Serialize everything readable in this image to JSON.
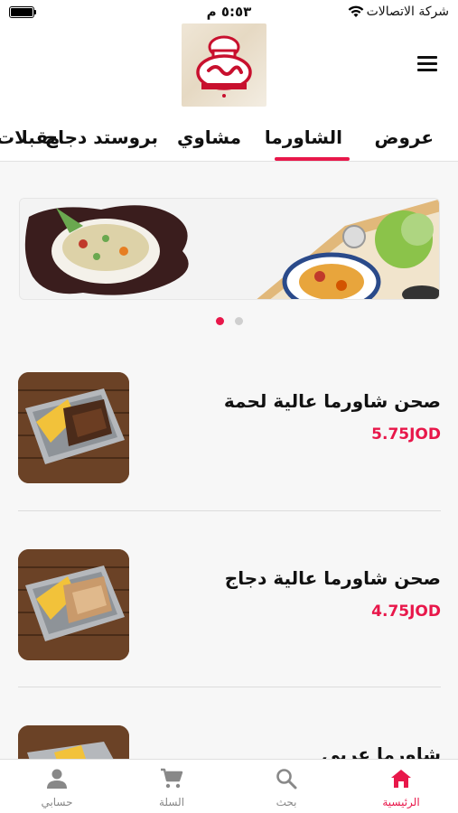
{
  "status_bar": {
    "time": "٥:٥٣ م",
    "carrier": "شركة الاتصالات"
  },
  "header": {
    "logo_alt": "عالية"
  },
  "tabs": [
    {
      "label": "عروض"
    },
    {
      "label": "الشاورما",
      "active": true
    },
    {
      "label": "مشاوي"
    },
    {
      "label": "بروستد دجاج"
    },
    {
      "label": "مقبلات"
    }
  ],
  "banner": {
    "slide_count": 2,
    "active_slide": 1
  },
  "items": [
    {
      "name": "صحن شاورما عالية لحمة",
      "price": "5.75JOD"
    },
    {
      "name": "صحن شاورما عالية دجاج",
      "price": "4.75JOD"
    },
    {
      "name": "شاورما عربي",
      "price": ""
    }
  ],
  "bottom_nav": [
    {
      "label": "الرئيسية",
      "icon": "home-icon",
      "active": true
    },
    {
      "label": "بحث",
      "icon": "search-icon"
    },
    {
      "label": "السلة",
      "icon": "cart-icon"
    },
    {
      "label": "حسابي",
      "icon": "user-icon"
    }
  ],
  "colors": {
    "accent": "#e8174a",
    "text": "#111111",
    "muted": "#888888",
    "background": "#f7f7f7"
  }
}
